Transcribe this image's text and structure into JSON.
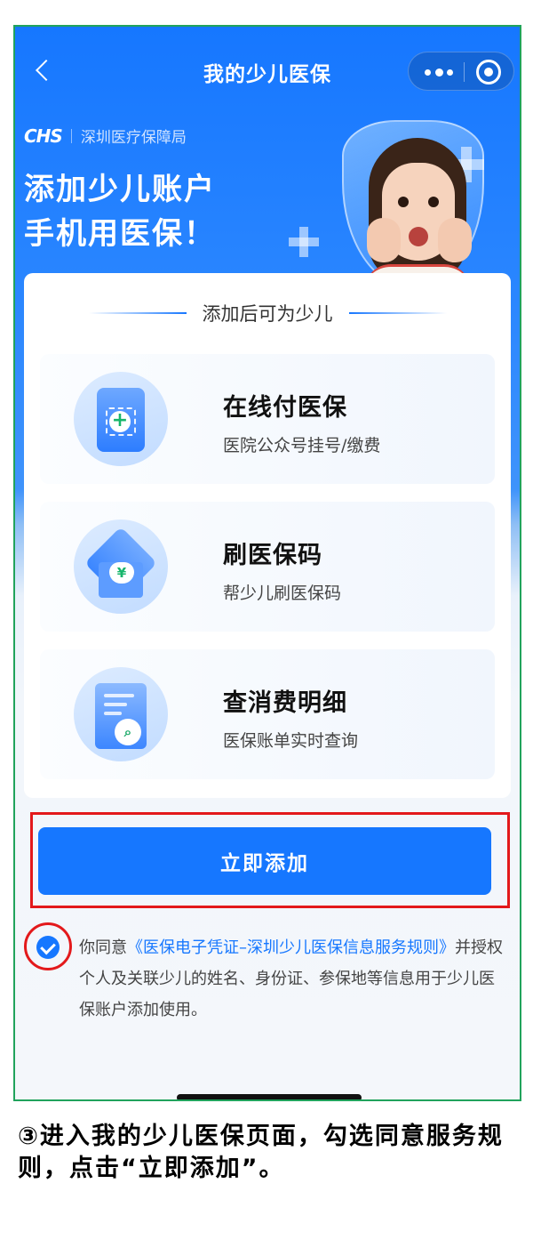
{
  "nav": {
    "title": "我的少儿医保"
  },
  "brand": {
    "logo_text": "CHS",
    "org_name": "深圳医疗保障局"
  },
  "headline": {
    "line1": "添加少儿账户",
    "line2": "手机用医保！"
  },
  "card": {
    "heading": "添加后可为少儿",
    "features": [
      {
        "title": "在线付医保",
        "subtitle": "医院公众号挂号/缴费",
        "icon": "phone-plus-icon"
      },
      {
        "title": "刷医保码",
        "subtitle": "帮少儿刷医保码",
        "icon": "house-yen-icon"
      },
      {
        "title": "查消费明细",
        "subtitle": "医保账单实时查询",
        "icon": "bill-search-icon"
      }
    ]
  },
  "cta": {
    "label": "立即添加"
  },
  "agreement": {
    "prefix": "你同意",
    "link": "《医保电子凭证–深圳少儿医保信息服务规则》",
    "suffix": "并授权个人及关联少儿的姓名、身份证、参保地等信息用于少儿医保账户添加使用。"
  },
  "caption": {
    "text": "③进入我的少儿医保页面，勾选同意服务规则，点击“立即添加”。"
  },
  "colors": {
    "primary": "#1677ff",
    "highlight": "#e3191b",
    "frame": "#21a35c"
  }
}
